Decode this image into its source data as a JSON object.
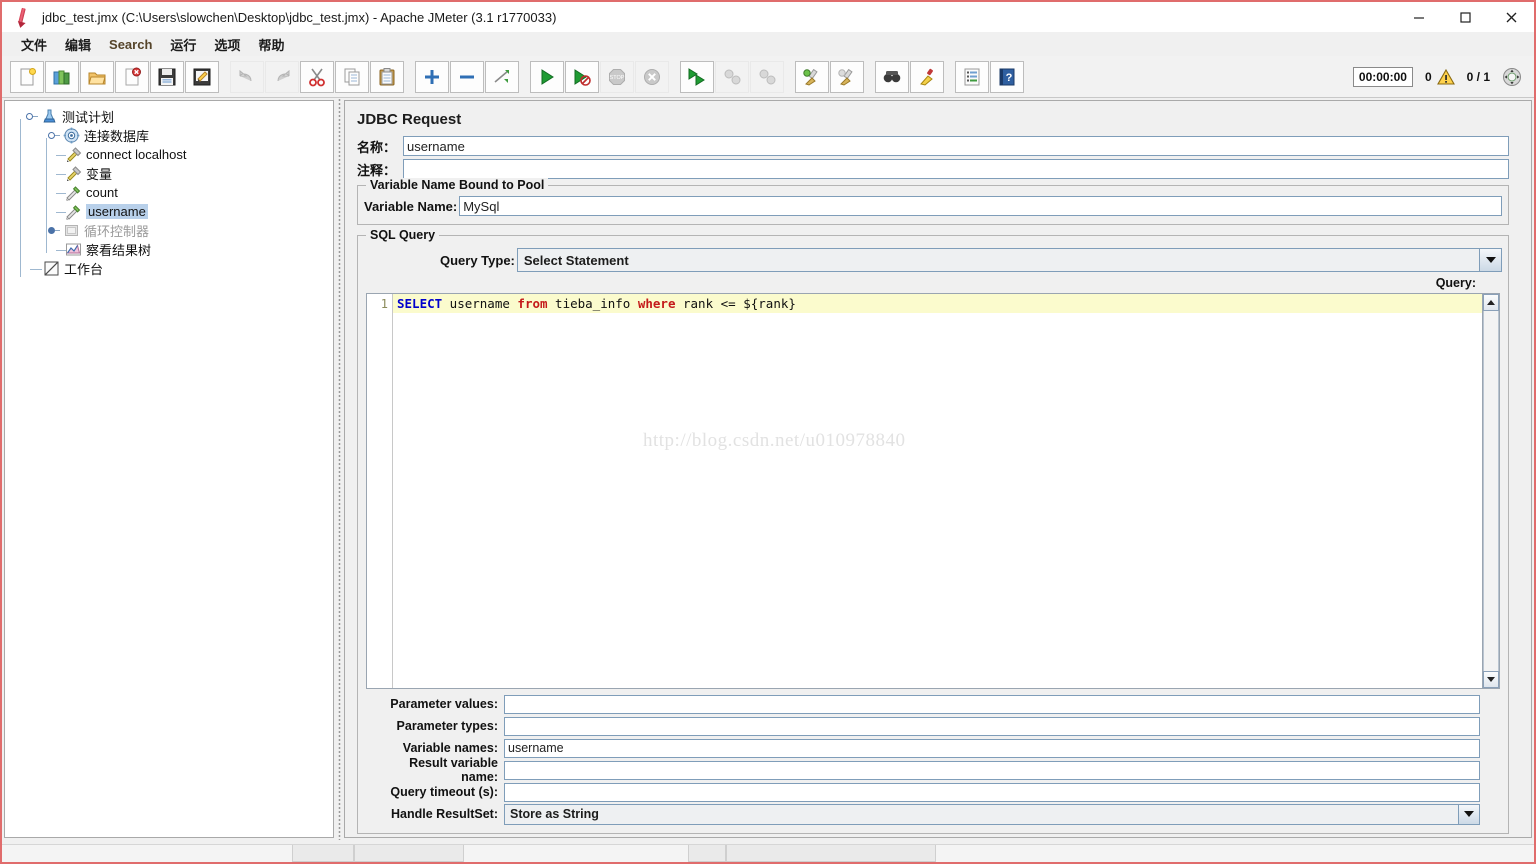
{
  "window": {
    "title": "jdbc_test.jmx (C:\\Users\\slowchen\\Desktop\\jdbc_test.jmx) - Apache JMeter (3.1 r1770033)",
    "app_icon": "jmeter-pen-icon",
    "minimize_label": "–",
    "maximize_label": "□",
    "close_label": "✕"
  },
  "menubar": {
    "items": [
      {
        "label": "文件",
        "name": "menu-file"
      },
      {
        "label": "编辑",
        "name": "menu-edit"
      },
      {
        "label": "Search",
        "name": "menu-search"
      },
      {
        "label": "运行",
        "name": "menu-run"
      },
      {
        "label": "选项",
        "name": "menu-options"
      },
      {
        "label": "帮助",
        "name": "menu-help"
      }
    ]
  },
  "toolbar": {
    "buttons": [
      {
        "name": "new-icon",
        "tip": "New"
      },
      {
        "name": "templates-icon",
        "tip": "Templates"
      },
      {
        "name": "open-icon",
        "tip": "Open"
      },
      {
        "name": "close-icon",
        "tip": "Close"
      },
      {
        "name": "save-icon",
        "tip": "Save"
      },
      {
        "name": "save-as-icon",
        "tip": "Save As"
      },
      {
        "name": "undo-icon",
        "tip": "Undo"
      },
      {
        "name": "redo-icon",
        "tip": "Redo"
      },
      {
        "name": "cut-icon",
        "tip": "Cut"
      },
      {
        "name": "copy-icon",
        "tip": "Copy"
      },
      {
        "name": "paste-icon",
        "tip": "Paste"
      },
      {
        "name": "expand-all-icon",
        "tip": "Expand All"
      },
      {
        "name": "collapse-all-icon",
        "tip": "Collapse All"
      },
      {
        "name": "toggle-icon",
        "tip": "Toggle"
      },
      {
        "name": "start-icon",
        "tip": "Start"
      },
      {
        "name": "start-no-pauses-icon",
        "tip": "Start no pauses"
      },
      {
        "name": "stop-icon",
        "tip": "Stop"
      },
      {
        "name": "shutdown-icon",
        "tip": "Shutdown"
      },
      {
        "name": "remote-start-all-icon",
        "tip": "Remote Start All"
      },
      {
        "name": "remote-stop-all-icon",
        "tip": "Remote Stop All"
      },
      {
        "name": "remote-shutdown-icon",
        "tip": "Remote Shutdown All"
      },
      {
        "name": "clear-icon",
        "tip": "Clear"
      },
      {
        "name": "clear-all-icon",
        "tip": "Clear All"
      },
      {
        "name": "search-icon",
        "tip": "Search"
      },
      {
        "name": "reset-search-icon",
        "tip": "Reset Search"
      },
      {
        "name": "function-helper-icon",
        "tip": "Function Helper Dialog"
      },
      {
        "name": "help-icon",
        "tip": "Help"
      }
    ],
    "status": {
      "timer": "00:00:00",
      "warning_count": "0",
      "warning_icon": "warning-triangle-icon",
      "threads": "0 / 1",
      "threads_icon": "thread-indicator-icon"
    }
  },
  "tree": {
    "nodes": [
      {
        "label": "测试计划",
        "icon": "test-plan-icon",
        "depth": 0,
        "state": "normal",
        "expander": "expanded"
      },
      {
        "label": "连接数据库",
        "icon": "thread-group-icon",
        "depth": 1,
        "state": "normal",
        "expander": "expanded"
      },
      {
        "label": "connect localhost",
        "icon": "config-element-icon",
        "depth": 2,
        "state": "normal",
        "expander": "none"
      },
      {
        "label": "变量",
        "icon": "config-element-icon",
        "depth": 2,
        "state": "normal",
        "expander": "none"
      },
      {
        "label": "count",
        "icon": "jdbc-request-icon",
        "depth": 2,
        "state": "normal",
        "expander": "none"
      },
      {
        "label": "username",
        "icon": "jdbc-request-icon",
        "depth": 2,
        "state": "selected",
        "expander": "none"
      },
      {
        "label": "循环控制器",
        "icon": "loop-controller-icon",
        "depth": 2,
        "state": "disabled",
        "expander": "collapsed"
      },
      {
        "label": "察看结果树",
        "icon": "view-results-tree-icon",
        "depth": 2,
        "state": "normal",
        "expander": "none"
      },
      {
        "label": "工作台",
        "icon": "workbench-icon",
        "depth": 0,
        "state": "normal",
        "expander": "none"
      }
    ]
  },
  "main": {
    "title": "JDBC Request",
    "name_label": "名称：",
    "name_value": "username",
    "comment_label": "注释：",
    "comment_value": "",
    "pool_group": {
      "legend": "Variable Name Bound to Pool",
      "variable_name_label": "Variable Name:",
      "variable_name_value": "MySql"
    },
    "sql_group": {
      "legend": "SQL Query",
      "query_type_label": "Query Type:",
      "query_type_value": "Select Statement",
      "query_caption": "Query:",
      "editor": {
        "line_number": "1",
        "tokens": [
          {
            "text": "SELECT",
            "kind": "keyword-blue"
          },
          {
            "text": " username ",
            "kind": "plain"
          },
          {
            "text": "from",
            "kind": "keyword-red"
          },
          {
            "text": " tieba_info ",
            "kind": "plain"
          },
          {
            "text": "where",
            "kind": "keyword-red"
          },
          {
            "text": " rank <= ${rank}",
            "kind": "plain"
          }
        ],
        "plain_text": "SELECT username from tieba_info where rank <= ${rank}"
      },
      "watermark": "http://blog.csdn.net/u010978840",
      "params": [
        {
          "label": "Parameter values:",
          "value": "",
          "type": "text",
          "name": "parameter-values"
        },
        {
          "label": "Parameter types:",
          "value": "",
          "type": "text",
          "name": "parameter-types"
        },
        {
          "label": "Variable names:",
          "value": "username",
          "type": "text",
          "name": "variable-names"
        },
        {
          "label": "Result variable name:",
          "value": "",
          "type": "text",
          "name": "result-variable-name"
        },
        {
          "label": "Query timeout (s):",
          "value": "",
          "type": "text",
          "name": "query-timeout"
        },
        {
          "label": "Handle ResultSet:",
          "value": "Store as String",
          "type": "combo",
          "name": "handle-resultset"
        }
      ]
    }
  },
  "colors": {
    "accent_border": "#e06c6c",
    "selection": "#b8d0ea",
    "editor_line_highlight": "#fbfbcd",
    "keyword_blue": "#0000cd",
    "keyword_red": "#c41a1a",
    "panel_bg": "#f0f0f0"
  }
}
